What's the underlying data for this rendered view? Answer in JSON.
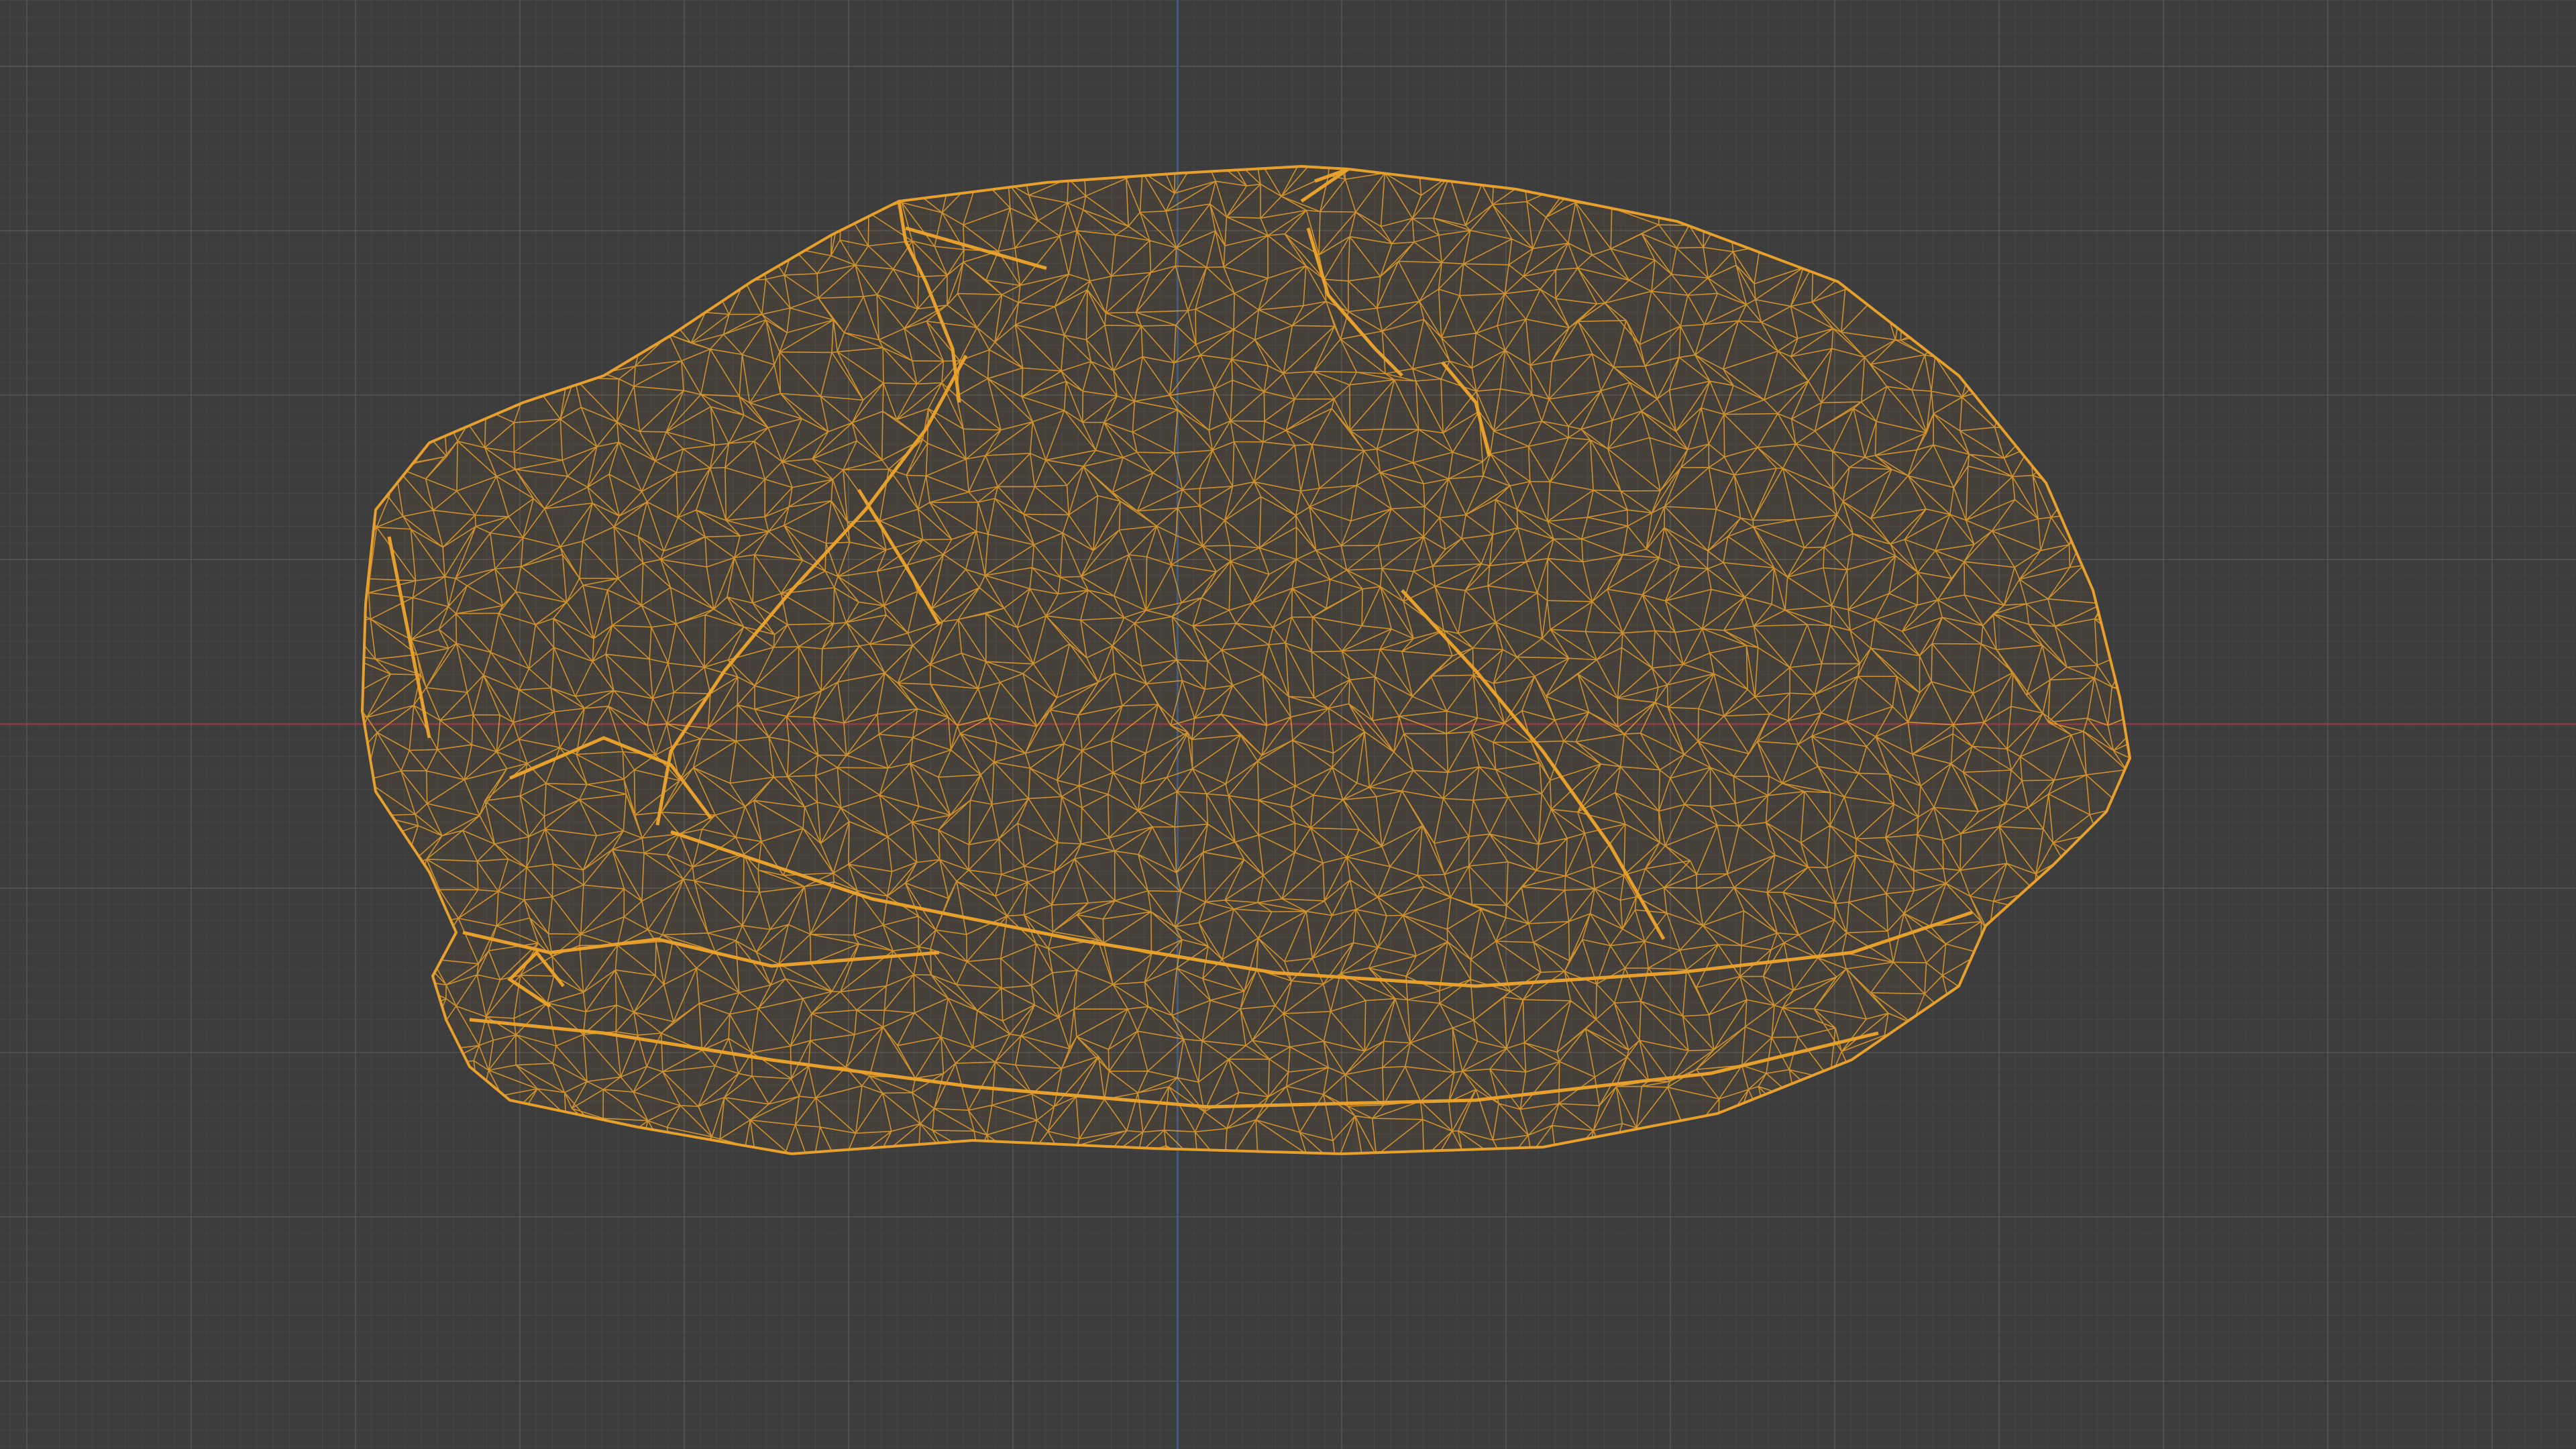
{
  "viewport": {
    "background_color": "#3d3d3d",
    "grid": true,
    "axis_x_color": "#8c3a47",
    "axis_z_color": "#3f5f8e"
  },
  "object": {
    "display_mode": "wireframe",
    "selected": true,
    "wire_color": "#e8a02c"
  }
}
